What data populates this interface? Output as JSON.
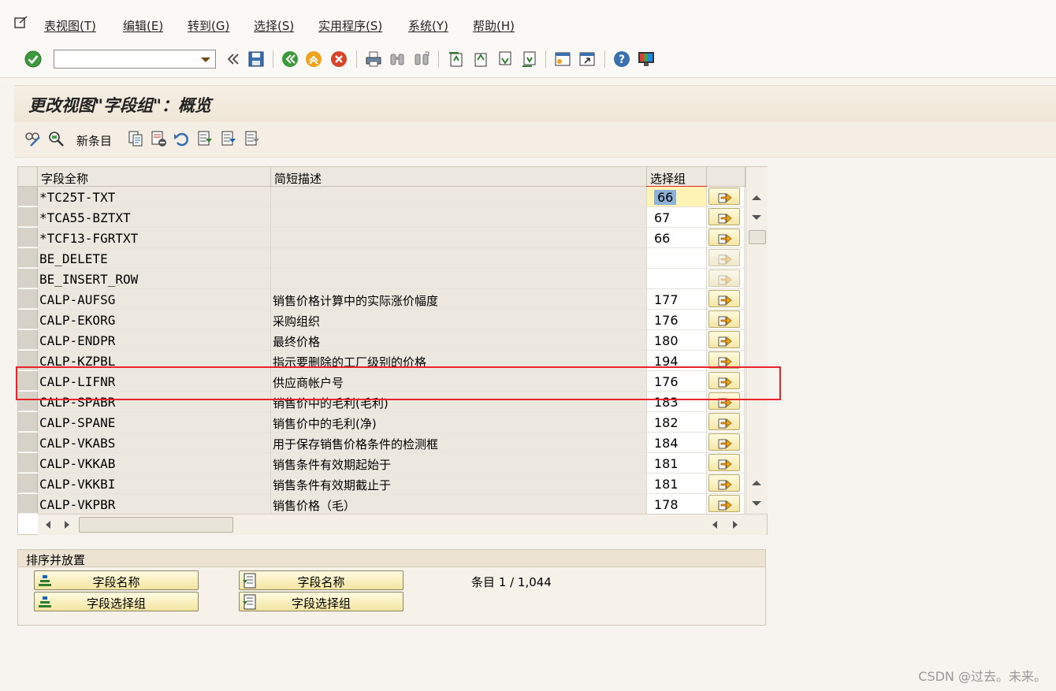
{
  "menu": [
    "表视图(T)",
    "编辑(E)",
    "转到(G)",
    "选择(S)",
    "实用程序(S)",
    "系统(Y)",
    "帮助(H)"
  ],
  "toolbar": {
    "command_value": ""
  },
  "title": "更改视图\"字段组\"：概览",
  "app_toolbar": {
    "new_entries": "新条目"
  },
  "table": {
    "headers": [
      "字段全称",
      "简短描述",
      "选择组"
    ],
    "rows": [
      {
        "field": "*TC25T-TXT",
        "desc": "",
        "group": "66"
      },
      {
        "field": "*TCA55-BZTXT",
        "desc": "",
        "group": "67"
      },
      {
        "field": "*TCF13-FGRTXT",
        "desc": "",
        "group": "66"
      },
      {
        "field": "BE_DELETE",
        "desc": "",
        "group": ""
      },
      {
        "field": "BE_INSERT_ROW",
        "desc": "",
        "group": ""
      },
      {
        "field": "CALP-AUFSG",
        "desc": "销售价格计算中的实际涨价幅度",
        "group": "177"
      },
      {
        "field": "CALP-EKORG",
        "desc": "采购组织",
        "group": "176"
      },
      {
        "field": "CALP-ENDPR",
        "desc": "最终价格",
        "group": "180"
      },
      {
        "field": "CALP-KZPBL",
        "desc": "指示要删除的工厂级别的价格",
        "group": "194"
      },
      {
        "field": "CALP-LIFNR",
        "desc": "供应商帐户号",
        "group": "176"
      },
      {
        "field": "CALP-SPABR",
        "desc": "销售价中的毛利(毛利)",
        "group": "183"
      },
      {
        "field": "CALP-SPANE",
        "desc": "销售价中的毛利(净)",
        "group": "182"
      },
      {
        "field": "CALP-VKABS",
        "desc": "用于保存销售价格条件的检测框",
        "group": "184"
      },
      {
        "field": "CALP-VKKAB",
        "desc": "销售条件有效期起始于",
        "group": "181"
      },
      {
        "field": "CALP-VKKBI",
        "desc": "销售条件有效期截止于",
        "group": "181"
      },
      {
        "field": "CALP-VKPBR",
        "desc": "销售价格（毛）",
        "group": "178"
      }
    ]
  },
  "sort": {
    "title": "排序并放置",
    "buttons": [
      "字段名称",
      "字段选择组",
      "字段名称",
      "字段选择组"
    ],
    "entries": "条目 1 / 1,044"
  },
  "watermark": "CSDN @过去。未来。"
}
